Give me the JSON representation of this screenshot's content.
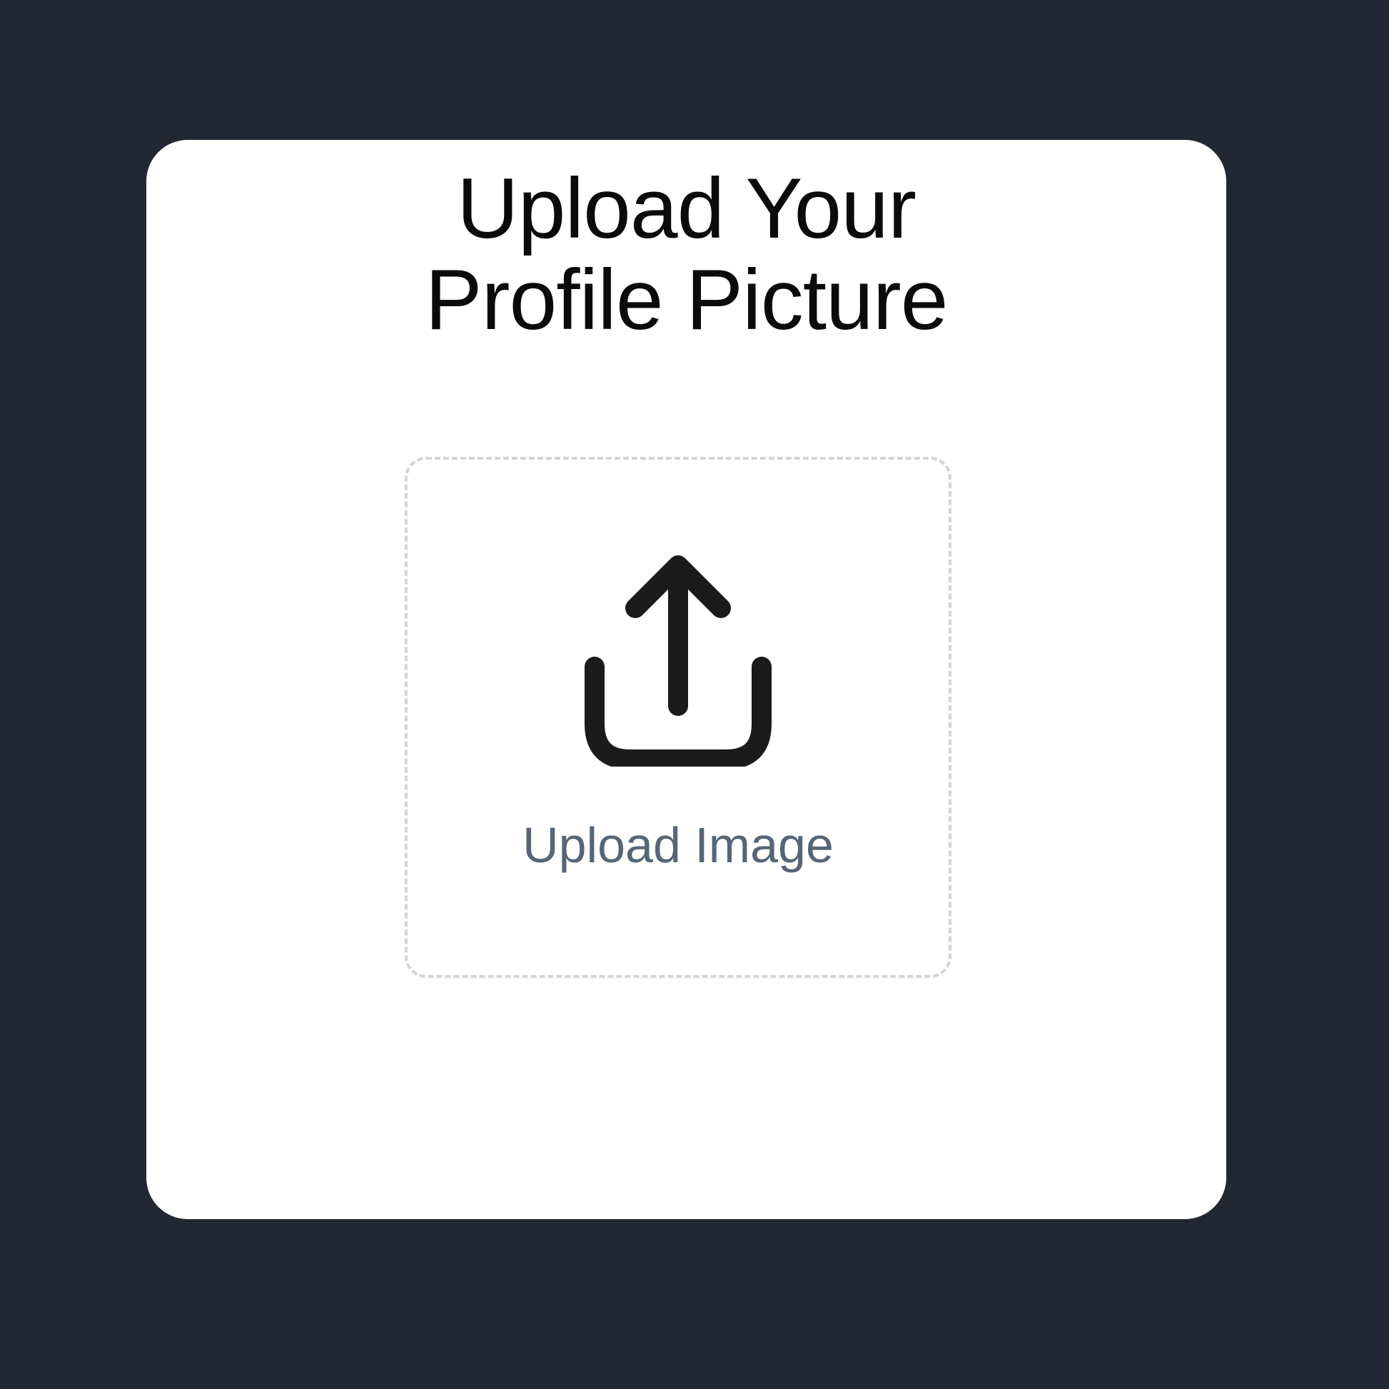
{
  "card": {
    "title_line1": "Upload Your",
    "title_line2": "Profile Picture"
  },
  "dropzone": {
    "label": "Upload Image",
    "icon": "upload-icon"
  },
  "colors": {
    "background": "#232733",
    "card": "#ffffff",
    "title": "#0b0b0b",
    "label": "#566577",
    "dashed_border": "#d2d4db",
    "icon": "#1b1b1b"
  }
}
